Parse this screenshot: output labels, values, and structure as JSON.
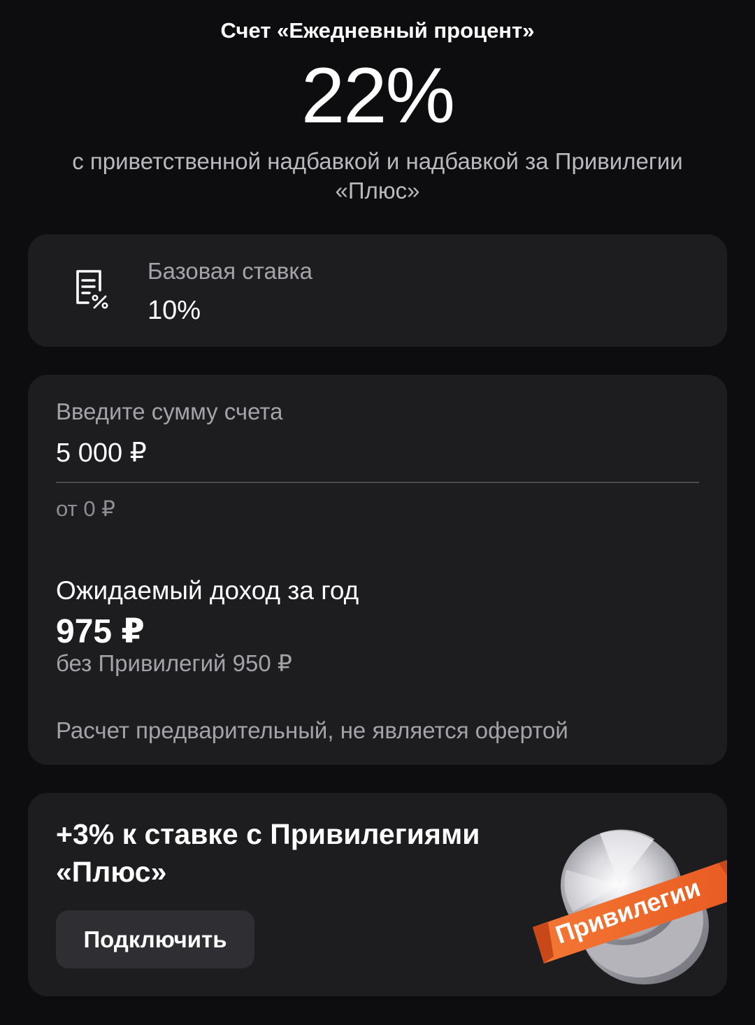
{
  "header": {
    "account_title": "Счет «Ежедневный процент»",
    "rate": "22%",
    "subtitle": "с приветственной надбавкой и надбавкой за Привилегии «Плюс»"
  },
  "base_rate": {
    "icon": "document-percent-icon",
    "label": "Базовая ставка",
    "value": "10%"
  },
  "calculator": {
    "amount_label": "Введите сумму счета",
    "amount_value": "5 000 ₽",
    "amount_hint": "от 0 ₽",
    "income_label": "Ожидаемый доход за год",
    "income_value": "975 ₽",
    "income_without": "без Привилегий 950 ₽",
    "disclaimer": "Расчет предварительный, не является офертой"
  },
  "promo": {
    "title": "+3% к ставке с Привилегиями «Плюс»",
    "button_label": "Подключить",
    "badge_text": "Привилегии",
    "badge_color": "#f26b2c"
  },
  "colors": {
    "background": "#0d0d0f",
    "card": "#1d1d20",
    "secondary_text": "#a3a3a8",
    "button": "#2f2f33"
  }
}
